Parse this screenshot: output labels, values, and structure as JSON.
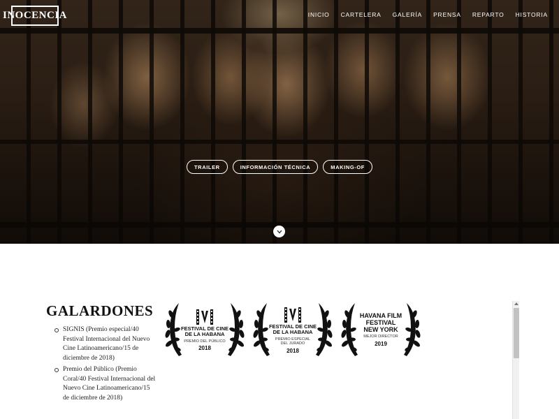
{
  "brand": {
    "logo_text": "INOCENCIA"
  },
  "nav": {
    "items": [
      {
        "label": "INICIO"
      },
      {
        "label": "CARTELERA"
      },
      {
        "label": "GALERÍA"
      },
      {
        "label": "PRENSA"
      },
      {
        "label": "REPARTO"
      },
      {
        "label": "HISTORIA"
      }
    ]
  },
  "hero": {
    "buttons": [
      {
        "label": "TRAILER"
      },
      {
        "label": "INFORMACIÓN TÉCNICA"
      },
      {
        "label": "MAKING-OF"
      }
    ],
    "scroll_icon": "chevron-down-icon"
  },
  "awards": {
    "title": "GALARDONES",
    "items": [
      "SIGNIS (Premio especial/40 Festival Internacional del Nuevo Cine Latinoamericano/15 de diciembre de 2018)",
      "Premio del Público (Premio Coral/40 Festival Internacional del Nuevo Cine Latinoamericano/15 de diciembre de 2018)"
    ],
    "laurels": [
      {
        "title_line1": "FESTIVAL DE CINE",
        "title_line2": "DE LA HABANA",
        "subtitle_line1": "PREMIO DEL PÚBLICO",
        "subtitle_line2": "",
        "year": "2018"
      },
      {
        "title_line1": "FESTIVAL DE CINE",
        "title_line2": "DE LA HABANA",
        "subtitle_line1": "PREMIO ESPECIAL",
        "subtitle_line2": "DEL JURADO",
        "year": "2018"
      },
      {
        "title_line1": "HAVANA FILM",
        "title_line2": "FESTIVAL",
        "title_line3": "NEW YORK",
        "subtitle_line1": "MEJOR DIRECTOR",
        "year": "2019"
      }
    ]
  },
  "colors": {
    "hero_dark": "#1a120c",
    "text": "#111111",
    "accent": "#ffffff"
  }
}
